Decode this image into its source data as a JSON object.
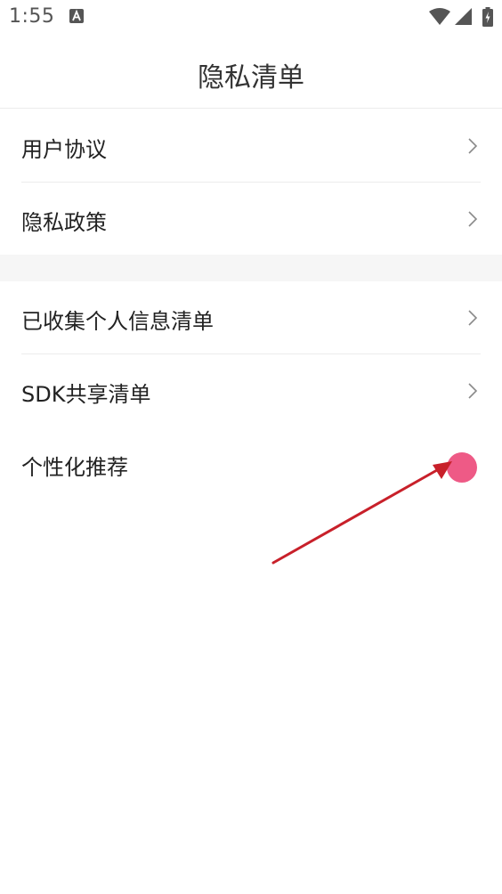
{
  "status_bar": {
    "time": "1:55",
    "icons": [
      "notification-a-icon",
      "wifi-icon",
      "signal-icon",
      "battery-charging-icon"
    ]
  },
  "header": {
    "title": "隐私清单"
  },
  "sections": [
    {
      "items": [
        {
          "label": "用户协议",
          "control": "chevron-right-icon"
        },
        {
          "label": "隐私政策",
          "control": "chevron-right-icon"
        }
      ]
    },
    {
      "items": [
        {
          "label": "已收集个人信息清单",
          "control": "chevron-right-icon"
        },
        {
          "label": "SDK共享清单",
          "control": "chevron-right-icon"
        },
        {
          "label": "个性化推荐",
          "control": "toggle"
        }
      ]
    }
  ],
  "colors": {
    "toggle_accent": "#ee5a86",
    "annotation_arrow": "#c8202a",
    "divider": "#ececec",
    "section_gap": "#f6f6f6"
  }
}
